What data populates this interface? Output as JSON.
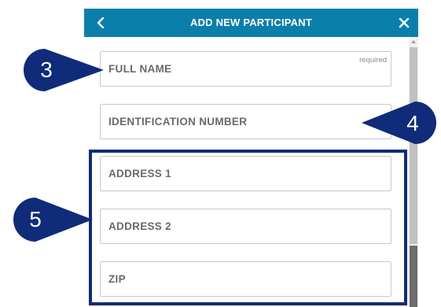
{
  "header": {
    "title": "ADD NEW PARTICIPANT",
    "back_icon": "chevron-left-icon",
    "close_icon": "close-icon",
    "bg_color": "#0b7fab"
  },
  "form": {
    "full_name": {
      "placeholder": "FULL NAME",
      "required_label": "required"
    },
    "identification_number": {
      "placeholder": "IDENTIFICATION NUMBER"
    },
    "address1": {
      "placeholder": "ADDRESS 1"
    },
    "address2": {
      "placeholder": "ADDRESS 2"
    },
    "zip": {
      "placeholder": "ZIP"
    }
  },
  "annotations": {
    "callout_3": "3",
    "callout_4": "4",
    "callout_5": "5",
    "color": "#0f2b7a"
  }
}
